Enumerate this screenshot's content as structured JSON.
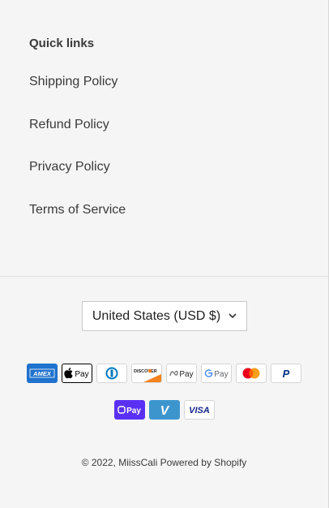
{
  "quick_links": {
    "title": "Quick links",
    "items": [
      {
        "label": "Shipping Policy"
      },
      {
        "label": "Refund Policy"
      },
      {
        "label": "Privacy Policy"
      },
      {
        "label": "Terms of Service"
      }
    ]
  },
  "currency_selector": {
    "selected": "United States (USD $)",
    "icon": "chevron-down-icon"
  },
  "payment_icons": {
    "amex": "AMEX",
    "apple_pay": "Pay",
    "discover": "DISCOVER",
    "meta_pay": "Pay",
    "google_pay": "Pay",
    "shop_pay": "Pay",
    "venmo": "V",
    "visa": "VISA",
    "paypal": "P"
  },
  "footer": {
    "copyright": "© 2022,",
    "store_name": "MiissCali",
    "powered_by": "Powered by Shopify"
  },
  "colors": {
    "background": "#f5f5f5",
    "text": "#3a3a3a",
    "amex": "#1f72cd",
    "shop_pay": "#5a31f4",
    "venmo": "#3d95ce",
    "visa": "#142688",
    "paypal": "#003087",
    "mastercard_red": "#eb001b",
    "mastercard_orange": "#f79e1b"
  }
}
